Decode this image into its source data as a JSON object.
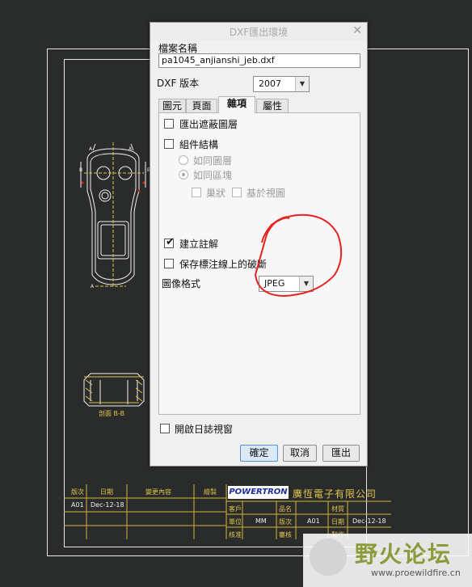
{
  "dialog": {
    "title": "DXF匯出環境",
    "filename_label": "檔案名稱",
    "filename_value": "pa1045_anjianshi_jeb.dxf",
    "version_label": "DXF 版本",
    "version_value": "2007",
    "tabs": [
      {
        "label": "圖元",
        "active": false
      },
      {
        "label": "頁面",
        "active": false
      },
      {
        "label": "雜項",
        "active": true
      },
      {
        "label": "屬性",
        "active": false
      }
    ],
    "options": {
      "export_hidden_layers": {
        "label": "匯出遮蔽圖層",
        "checked": false
      },
      "component_structure": {
        "label": "組件結構",
        "checked": false
      },
      "as_layer": {
        "label": "如同圖層",
        "selected": false,
        "enabled": false
      },
      "as_block": {
        "label": "如同區塊",
        "selected": true,
        "enabled": false
      },
      "nested": {
        "label": "巢狀",
        "checked": false,
        "enabled": false
      },
      "based_on_view": {
        "label": "基於視圖",
        "checked": false,
        "enabled": false
      },
      "create_annotations": {
        "label": "建立註解",
        "checked": true
      },
      "keep_broken_leaders": {
        "label": "保存標注線上的破斷",
        "checked": false
      },
      "image_format_label": "圖像格式",
      "image_format_value": "JPEG"
    },
    "open_log_label": "開啟日誌視窗",
    "open_log_checked": false,
    "buttons": {
      "ok": "確定",
      "cancel": "取消",
      "export": "匯出"
    },
    "close_icon": "close-icon"
  },
  "cad": {
    "section_label": "剖面 B-B",
    "brand": "POWERTRON",
    "company": "廣恆電子有限公司",
    "title_block": {
      "col_version": "版次",
      "col_date": "日期",
      "col_change": "變更內容",
      "col_drawn": "繪製",
      "row_version": "A01",
      "row_date": "Dec-12-18",
      "customer": "客戶",
      "name": "品名",
      "material": "材質",
      "unit": "單位",
      "unit_value": "MM",
      "version": "版次",
      "version_value": "A01",
      "date": "日期",
      "date_value": "Dec-12-18",
      "check": "核准",
      "review": "審核",
      "make": "製作"
    }
  },
  "watermark": {
    "title": "野火论坛",
    "url": "www.proewildfire.cn"
  },
  "colors": {
    "cad_bg": "#2a2c2b",
    "title_block": "#e3c24a",
    "annotation_red": "#e8201e"
  }
}
